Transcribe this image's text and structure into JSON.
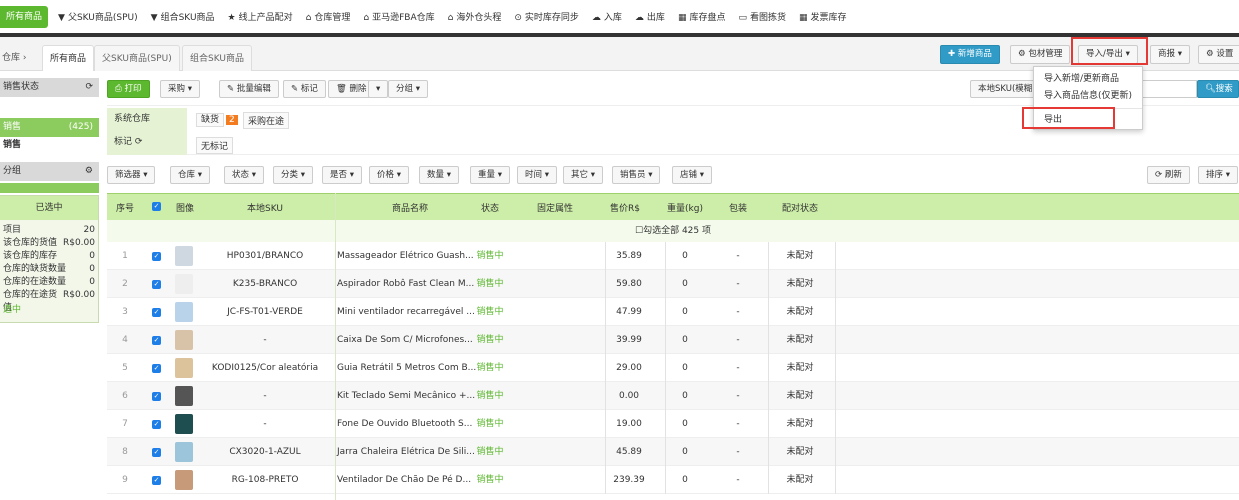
{
  "topnav": {
    "first": "所有商品",
    "items": [
      {
        "icon": "▼",
        "label": "父SKU商品(SPU)"
      },
      {
        "icon": "▼",
        "label": "组合SKU商品"
      },
      {
        "icon": "★",
        "label": "线上产品配对"
      },
      {
        "icon": "⌂",
        "label": "仓库管理"
      },
      {
        "icon": "⌂",
        "label": "亚马逊FBA仓库"
      },
      {
        "icon": "⌂",
        "label": "海外仓头程"
      },
      {
        "icon": "⊙",
        "label": "实时库存同步"
      },
      {
        "icon": "☁",
        "label": "入库"
      },
      {
        "icon": "☁",
        "label": "出库"
      },
      {
        "icon": "▦",
        "label": "库存盘点"
      },
      {
        "icon": "▭",
        "label": "看图拣货"
      },
      {
        "icon": "▦",
        "label": "发票库存"
      }
    ]
  },
  "breadcrumb": "仓库 ›",
  "tabs": [
    "所有商品",
    "父SKU商品(SPU)",
    "组合SKU商品"
  ],
  "header_buttons": {
    "add": "✚ 新增商品",
    "packing": "⚙ 包材管理",
    "import_export": "导入/导出 ▾",
    "report": "商报 ▾",
    "settings": "⚙ 设置"
  },
  "dropdown": [
    "导入新增/更新商品",
    "导入商品信息(仅更新)",
    "导出"
  ],
  "sidebar": {
    "status_title": "销售状态",
    "selling": "销售",
    "selling_count": "(425)",
    "selling2": "销售",
    "group_title": "分组",
    "selected_title": "已选中",
    "stats": [
      {
        "label": "项目",
        "value": "20"
      },
      {
        "label": "该仓库的货值",
        "value": "R$0.00"
      },
      {
        "label": "该仓库的库存",
        "value": "0"
      },
      {
        "label": "仓库的缺货数量",
        "value": "0"
      },
      {
        "label": "仓库的在途数量",
        "value": "0"
      },
      {
        "label": "仓库的在途货值",
        "value": "R$0.00"
      }
    ],
    "footer": "选中"
  },
  "toolbar": {
    "print": "⎙ 打印",
    "purchase": "采购 ▾",
    "batch_edit": "✎ 批量编辑",
    "mark": "✎ 标记",
    "delete": "🗑 删除",
    "more": "▾",
    "group": "分组 ▾",
    "search_select": "本地SKU(模糊",
    "search_btn": "搜索"
  },
  "filters": {
    "warehouse_label": "系统仓库",
    "stockout": "缺货",
    "stockout_count": "2",
    "in_transit": "采购在途",
    "mark_label": "标记 ⟳",
    "no_mark": "无标记"
  },
  "filter_buttons": [
    "筛选器 ▾",
    "仓库 ▾",
    "状态 ▾",
    "分类 ▾",
    "是否 ▾",
    "价格 ▾",
    "数量 ▾",
    "重量 ▾",
    "时间 ▾",
    "其它 ▾",
    "销售员 ▾",
    "店铺 ▾"
  ],
  "refresh": "⟳ 刷新",
  "sort": "排序 ▾",
  "columns": [
    "序号",
    "图像",
    "本地SKU",
    "商品名称",
    "状态",
    "固定属性",
    "售价R$",
    "重量(kg)",
    "包装",
    "配对状态"
  ],
  "select_all": "☐勾选全部 425 项",
  "rows": [
    {
      "no": "1",
      "sku": "HP0301/BRANCO",
      "name": "Massageador Elétrico Guash...",
      "status": "销售中",
      "price": "35.89",
      "weight": "0",
      "pack": "-",
      "pair": "未配对",
      "thumb": "#cfd8e0"
    },
    {
      "no": "2",
      "sku": "K235-BRANCO",
      "name": "Aspirador Robô Fast Clean M...",
      "status": "销售中",
      "price": "59.80",
      "weight": "0",
      "pack": "-",
      "pair": "未配对",
      "thumb": "#eeeeee"
    },
    {
      "no": "3",
      "sku": "JC-FS-T01-VERDE",
      "name": "Mini ventilador recarregável ...",
      "status": "销售中",
      "price": "47.99",
      "weight": "0",
      "pack": "-",
      "pair": "未配对",
      "thumb": "#b9d3ea"
    },
    {
      "no": "4",
      "sku": "-",
      "name": "Caixa De Som C/ Microfones...",
      "status": "销售中",
      "price": "39.99",
      "weight": "0",
      "pack": "-",
      "pair": "未配对",
      "thumb": "#d8c3a8"
    },
    {
      "no": "5",
      "sku": "KODI0125/Cor aleatória",
      "name": "Guia Retrátil 5 Metros Com B...",
      "status": "销售中",
      "price": "29.00",
      "weight": "0",
      "pack": "-",
      "pair": "未配对",
      "thumb": "#dcc39c"
    },
    {
      "no": "6",
      "sku": "-",
      "name": "Kit Teclado Semi Mecânico +...",
      "status": "销售中",
      "price": "0.00",
      "weight": "0",
      "pack": "-",
      "pair": "未配对",
      "thumb": "#555555"
    },
    {
      "no": "7",
      "sku": "-",
      "name": "Fone De Ouvido Bluetooth S...",
      "status": "销售中",
      "price": "19.00",
      "weight": "0",
      "pack": "-",
      "pair": "未配对",
      "thumb": "#1e4e50"
    },
    {
      "no": "8",
      "sku": "CX3020-1-AZUL",
      "name": "Jarra Chaleira Elétrica De Sili...",
      "status": "销售中",
      "price": "45.89",
      "weight": "0",
      "pack": "-",
      "pair": "未配对",
      "thumb": "#9cc4da"
    },
    {
      "no": "9",
      "sku": "RG-108-PRETO",
      "name": "Ventilador De Chão De Pé D...",
      "status": "销售中",
      "price": "239.39",
      "weight": "0",
      "pack": "-",
      "pair": "未配对",
      "thumb": "#c79a7a"
    }
  ]
}
